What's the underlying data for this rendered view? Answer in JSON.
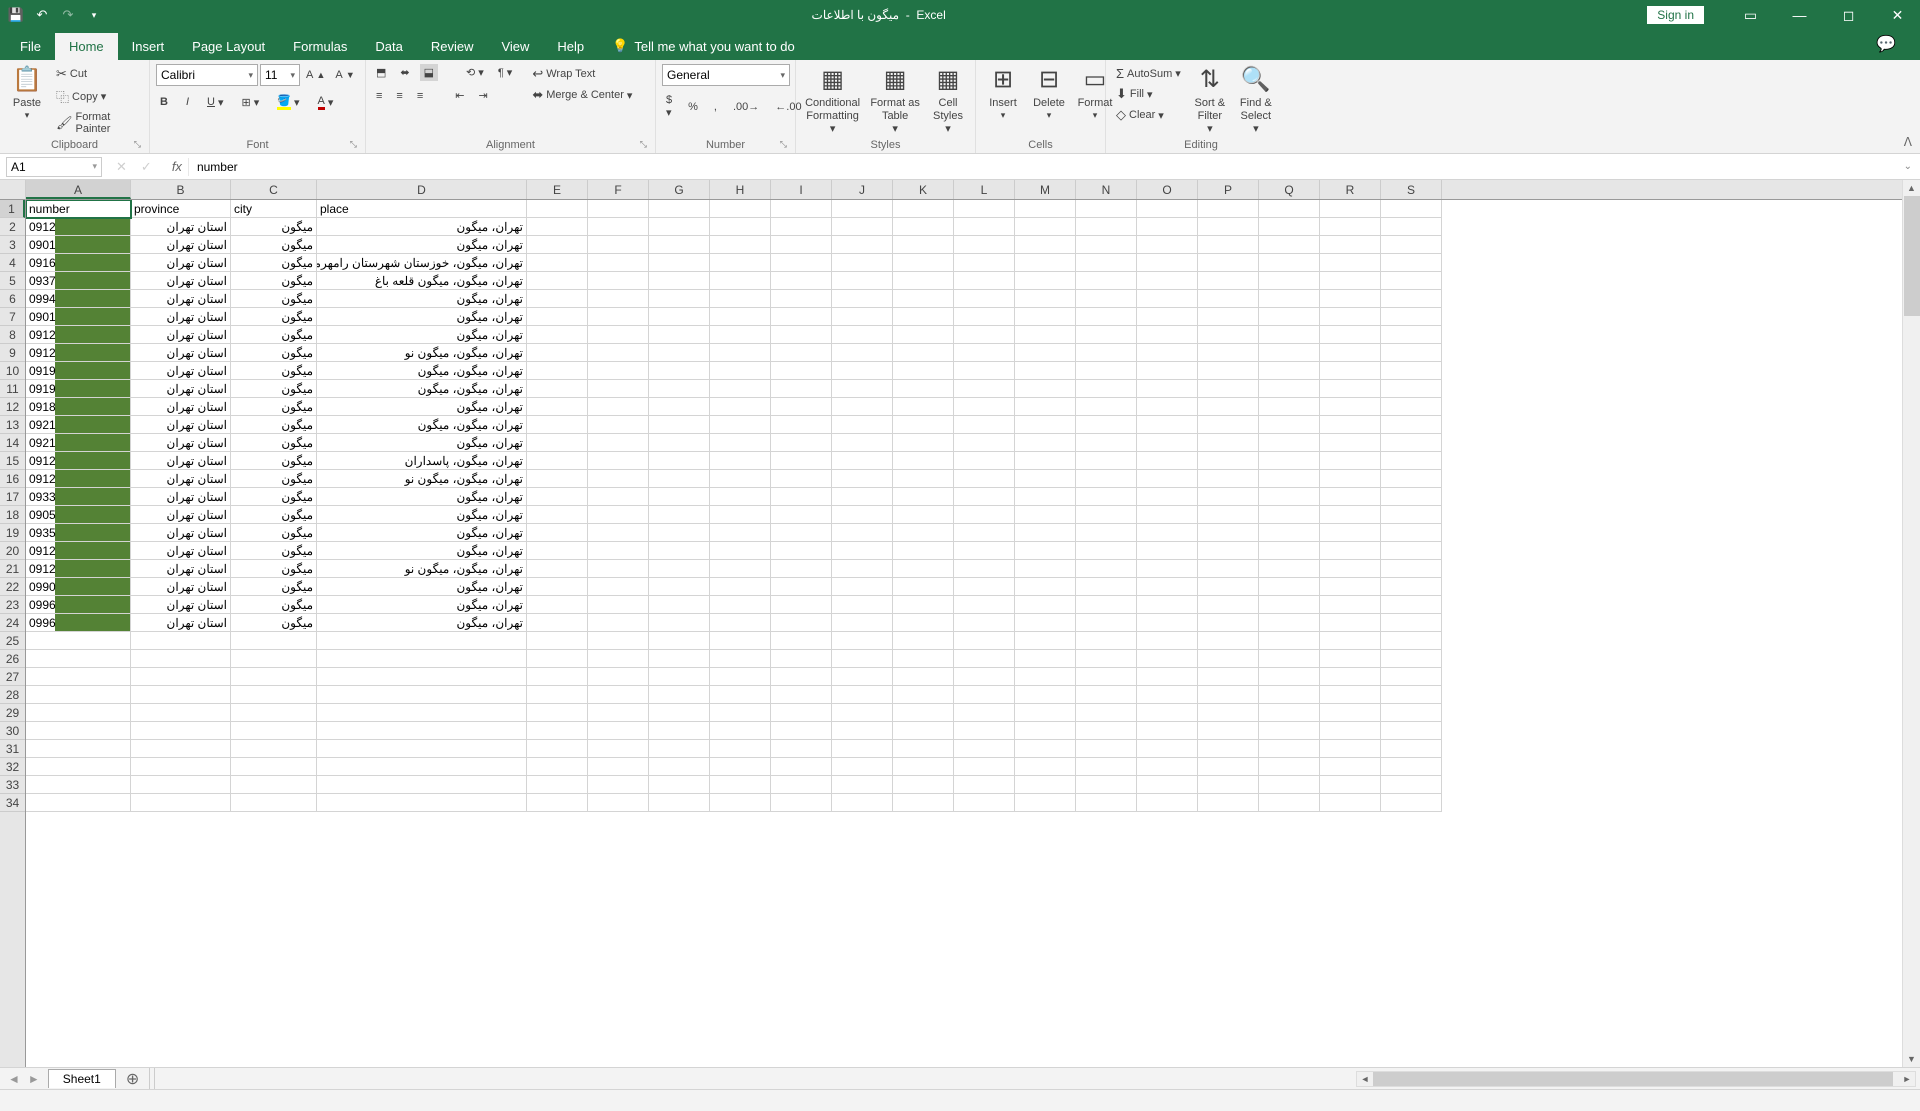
{
  "titlebar": {
    "doc": "میگون با اطلاعات",
    "app": "Excel",
    "signin": "Sign in"
  },
  "tabs": {
    "file": "File",
    "home": "Home",
    "insert": "Insert",
    "pagelayout": "Page Layout",
    "formulas": "Formulas",
    "data": "Data",
    "review": "Review",
    "view": "View",
    "help": "Help",
    "tellme": "Tell me what you want to do"
  },
  "ribbon": {
    "clipboard": {
      "label": "Clipboard",
      "paste": "Paste",
      "cut": "Cut",
      "copy": "Copy",
      "fp": "Format Painter"
    },
    "font": {
      "label": "Font",
      "name": "Calibri",
      "size": "11"
    },
    "alignment": {
      "label": "Alignment",
      "wrap": "Wrap Text",
      "merge": "Merge & Center"
    },
    "number": {
      "label": "Number",
      "format": "General"
    },
    "styles": {
      "label": "Styles",
      "cf": "Conditional\nFormatting",
      "fat": "Format as\nTable",
      "cs": "Cell\nStyles"
    },
    "cells": {
      "label": "Cells",
      "insert": "Insert",
      "delete": "Delete",
      "format": "Format"
    },
    "editing": {
      "label": "Editing",
      "autosum": "AutoSum",
      "fill": "Fill",
      "clear": "Clear",
      "sort": "Sort &\nFilter",
      "find": "Find &\nSelect"
    }
  },
  "formulabar": {
    "namebox": "A1",
    "value": "number"
  },
  "columns": [
    "A",
    "B",
    "C",
    "D",
    "E",
    "F",
    "G",
    "H",
    "I",
    "J",
    "K",
    "L",
    "M",
    "N",
    "O",
    "P",
    "Q",
    "R",
    "S"
  ],
  "headers": {
    "A": "number",
    "B": "province",
    "C": "city",
    "D": "place"
  },
  "rows": [
    {
      "n": "0912",
      "prov": "استان تهران",
      "city": "میگون",
      "place": "تهران، میگون"
    },
    {
      "n": "0901",
      "prov": "استان تهران",
      "city": "میگون",
      "place": "تهران، میگون"
    },
    {
      "n": "0916",
      "prov": "استان تهران",
      "city": "میگون",
      "place": "تهران، میگون، خوزستان شهرستان رامهرمز"
    },
    {
      "n": "0937",
      "prov": "استان تهران",
      "city": "میگون",
      "place": "تهران، میگون، میگون قلعه باغ"
    },
    {
      "n": "0994",
      "prov": "استان تهران",
      "city": "میگون",
      "place": "تهران، میگون"
    },
    {
      "n": "0901",
      "prov": "استان تهران",
      "city": "میگون",
      "place": "تهران، میگون"
    },
    {
      "n": "0912",
      "prov": "استان تهران",
      "city": "میگون",
      "place": "تهران، میگون"
    },
    {
      "n": "0912",
      "prov": "استان تهران",
      "city": "میگون",
      "place": "تهران، میگون، میگون نو"
    },
    {
      "n": "0919",
      "prov": "استان تهران",
      "city": "میگون",
      "place": "تهران، میگون، میگون"
    },
    {
      "n": "0919",
      "prov": "استان تهران",
      "city": "میگون",
      "place": "تهران، میگون، میگون"
    },
    {
      "n": "0918",
      "prov": "استان تهران",
      "city": "میگون",
      "place": "تهران، میگون"
    },
    {
      "n": "0921",
      "prov": "استان تهران",
      "city": "میگون",
      "place": "تهران، میگون، میگون"
    },
    {
      "n": "0921",
      "prov": "استان تهران",
      "city": "میگون",
      "place": "تهران، میگون"
    },
    {
      "n": "0912",
      "prov": "استان تهران",
      "city": "میگون",
      "place": "تهران، میگون، پاسداران"
    },
    {
      "n": "0912",
      "prov": "استان تهران",
      "city": "میگون",
      "place": "تهران، میگون، میگون نو"
    },
    {
      "n": "0933",
      "prov": "استان تهران",
      "city": "میگون",
      "place": "تهران، میگون"
    },
    {
      "n": "0905",
      "prov": "استان تهران",
      "city": "میگون",
      "place": "تهران، میگون"
    },
    {
      "n": "0935",
      "prov": "استان تهران",
      "city": "میگون",
      "place": "تهران، میگون"
    },
    {
      "n": "0912",
      "prov": "استان تهران",
      "city": "میگون",
      "place": "تهران، میگون"
    },
    {
      "n": "0912",
      "prov": "استان تهران",
      "city": "میگون",
      "place": "تهران، میگون، میگون نو"
    },
    {
      "n": "0990",
      "prov": "استان تهران",
      "city": "میگون",
      "place": "تهران، میگون"
    },
    {
      "n": "0996",
      "prov": "استان تهران",
      "city": "میگون",
      "place": "تهران، میگون"
    },
    {
      "n": "0996",
      "prov": "استان تهران",
      "city": "میگون",
      "place": "تهران، میگون"
    }
  ],
  "sheet": {
    "name": "Sheet1"
  }
}
